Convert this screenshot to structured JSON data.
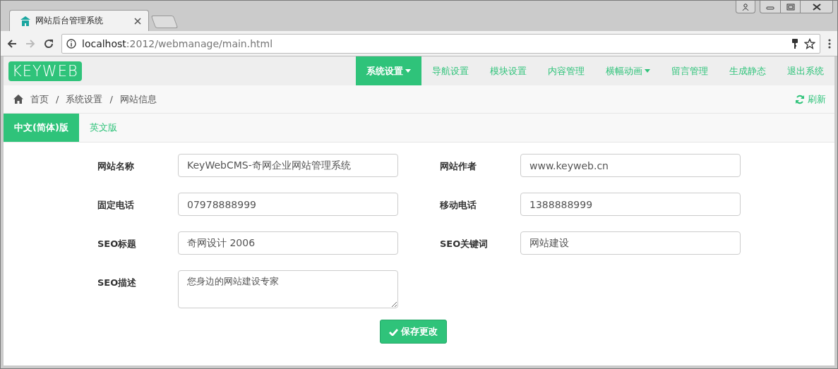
{
  "browser": {
    "tab_title": "网站后台管理系统",
    "url_host": "localhost",
    "url_path": ":2012/webmanage/main.html"
  },
  "navbar": {
    "logo": "KEYWEB",
    "items": [
      {
        "label": "系统设置",
        "selected": true,
        "dropdown": true
      },
      {
        "label": "导航设置",
        "selected": false,
        "dropdown": false
      },
      {
        "label": "模块设置",
        "selected": false,
        "dropdown": false
      },
      {
        "label": "内容管理",
        "selected": false,
        "dropdown": false
      },
      {
        "label": "横幅动画",
        "selected": false,
        "dropdown": true
      },
      {
        "label": "留言管理",
        "selected": false,
        "dropdown": false
      },
      {
        "label": "生成静态",
        "selected": false,
        "dropdown": false
      },
      {
        "label": "退出系统",
        "selected": false,
        "dropdown": false
      }
    ]
  },
  "breadcrumb": {
    "items": [
      "首页",
      "系统设置",
      "网站信息"
    ],
    "separators": [
      "/",
      "/"
    ]
  },
  "refresh": "刷新",
  "language_tabs": [
    {
      "label": "中文(简体)版",
      "selected": true
    },
    {
      "label": "英文版",
      "selected": false
    }
  ],
  "form": {
    "rows": [
      [
        {
          "label": "网站名称",
          "value": "KeyWebCMS-奇网企业网站管理系统"
        },
        {
          "label": "网站作者",
          "value": "www.keyweb.cn"
        }
      ],
      [
        {
          "label": "固定电话",
          "value": "07978888999"
        },
        {
          "label": "移动电话",
          "value": "1388888999"
        }
      ],
      [
        {
          "label": "SEO标题",
          "value": "奇网设计 2006"
        },
        {
          "label": "SEO关键词",
          "value": "网站建设"
        }
      ]
    ],
    "description": {
      "label": "SEO描述",
      "value": "您身边的网站建设专家"
    },
    "save_button": "保存更改"
  }
}
